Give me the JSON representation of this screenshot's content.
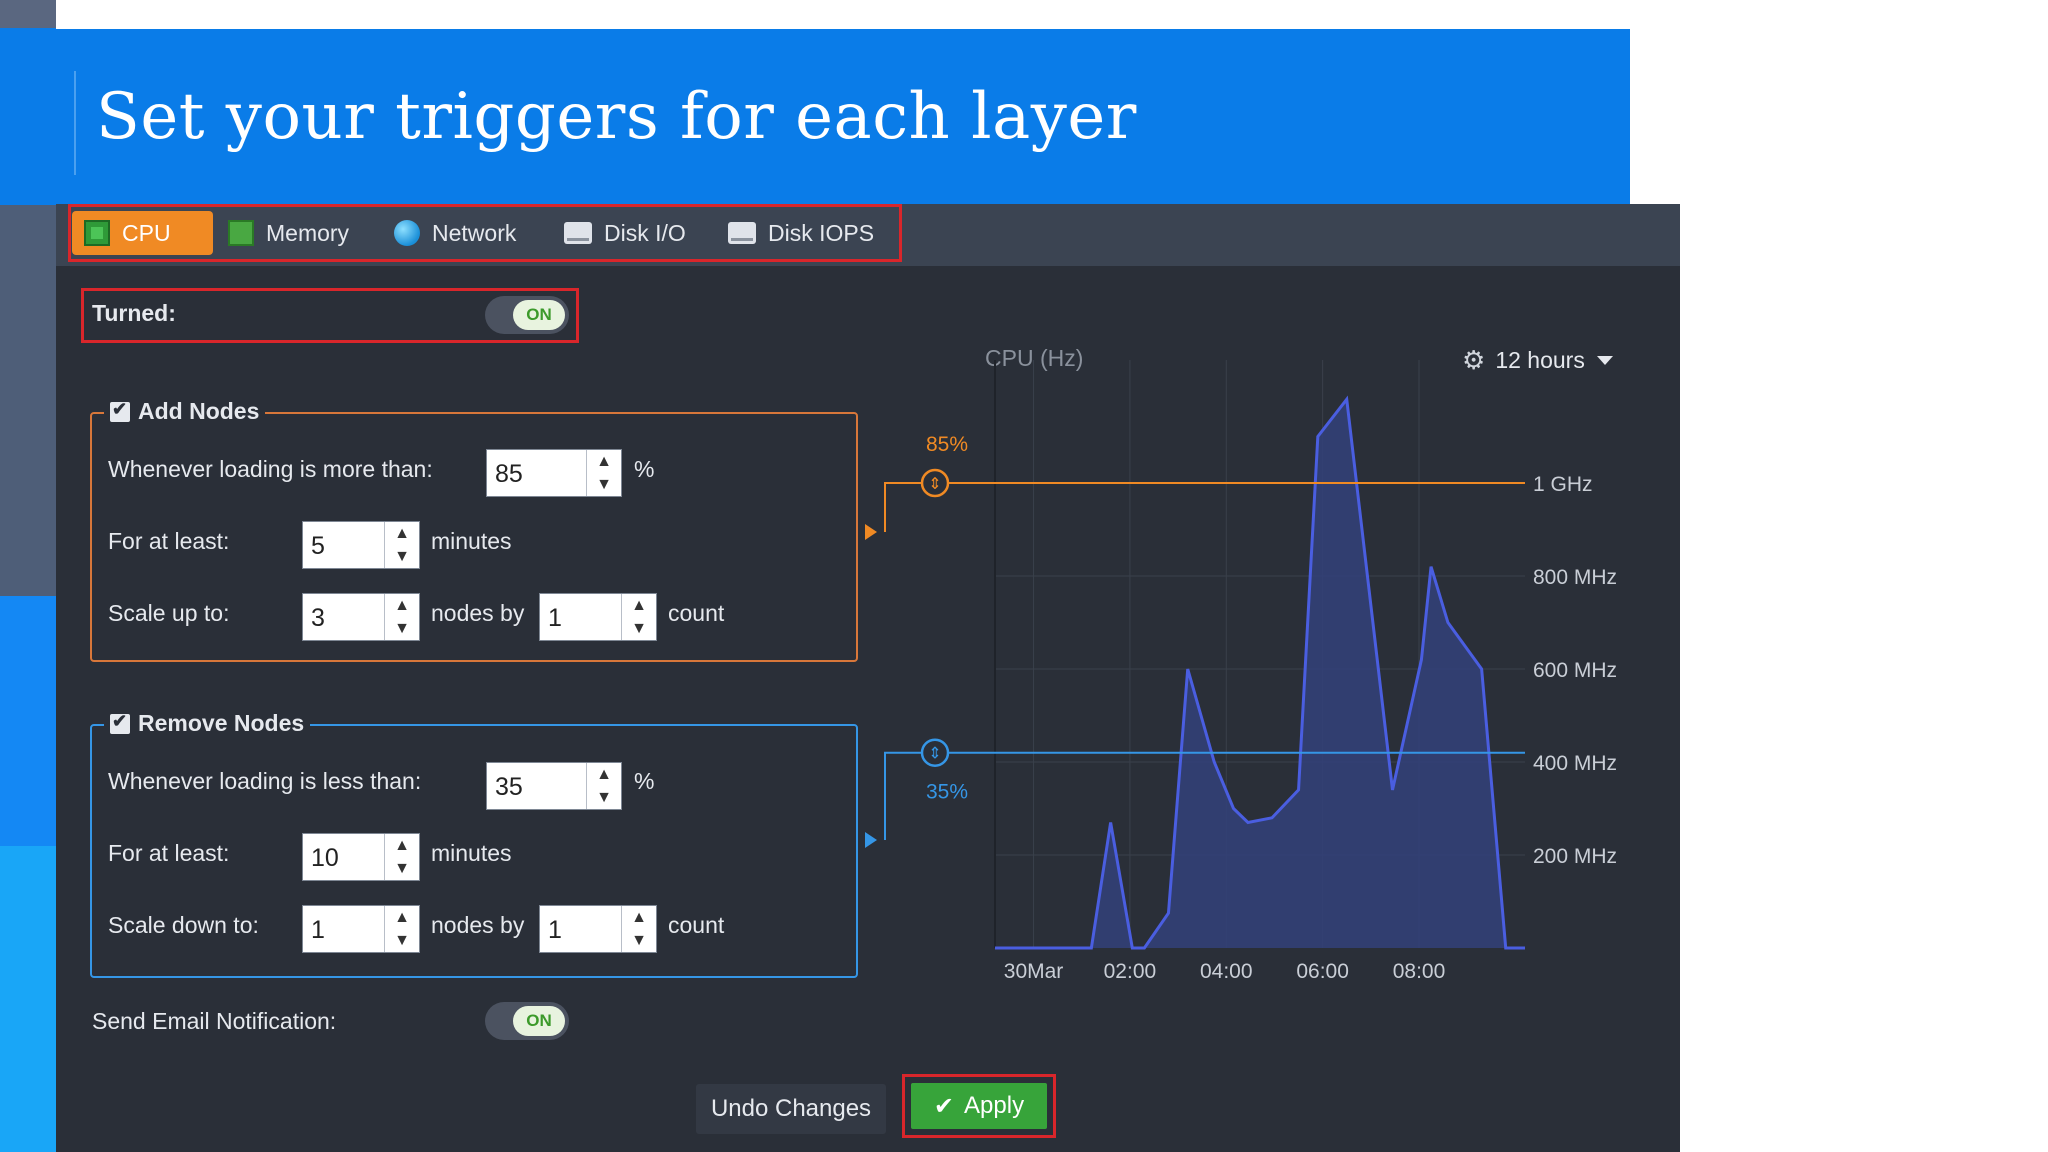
{
  "slide": {
    "title": "Set your triggers for each layer"
  },
  "tabs": [
    {
      "label": "CPU",
      "icon": "cpu-chip-icon",
      "active": true
    },
    {
      "label": "Memory",
      "icon": "memory-chip-icon",
      "active": false
    },
    {
      "label": "Network",
      "icon": "globe-icon",
      "active": false
    },
    {
      "label": "Disk I/O",
      "icon": "disk-icon",
      "active": false
    },
    {
      "label": "Disk IOPS",
      "icon": "disk-icon",
      "active": false
    }
  ],
  "turned": {
    "label": "Turned:",
    "state": "ON"
  },
  "add_nodes": {
    "legend": "Add Nodes",
    "checked": true,
    "loading_label": "Whenever loading is more than:",
    "loading_value": "85",
    "loading_unit": "%",
    "for_label": "For at least:",
    "for_value": "5",
    "for_unit": "minutes",
    "scale_label": "Scale up to:",
    "scale_value": "3",
    "nodes_by": "nodes by",
    "by_value": "1",
    "count": "count"
  },
  "remove_nodes": {
    "legend": "Remove Nodes",
    "checked": true,
    "loading_label": "Whenever loading is less than:",
    "loading_value": "35",
    "loading_unit": "%",
    "for_label": "For at least:",
    "for_value": "10",
    "for_unit": "minutes",
    "scale_label": "Scale down to:",
    "scale_value": "1",
    "nodes_by": "nodes by",
    "by_value": "1",
    "count": "count"
  },
  "email": {
    "label": "Send Email Notification:",
    "state": "ON"
  },
  "range_selector": {
    "label": "12 hours"
  },
  "buttons": {
    "undo": "Undo Changes",
    "apply": "Apply"
  },
  "colors": {
    "accent": "#f08a24",
    "remove": "#3596e6",
    "series": "#4a5ee0",
    "apply": "#37a43a",
    "highlight": "#d9262b"
  },
  "chart_data": {
    "type": "area",
    "title": "CPU (Hz)",
    "x_ticks": [
      "30Mar",
      "02:00",
      "04:00",
      "06:00",
      "08:00"
    ],
    "x_tick_hours": [
      0,
      2,
      4,
      6,
      8
    ],
    "y_ticks": [
      "200 MHz",
      "400 MHz",
      "600 MHz",
      "800 MHz",
      "1 GHz"
    ],
    "y_tick_values": [
      200,
      400,
      600,
      800,
      1000
    ],
    "ylim": [
      0,
      1200
    ],
    "xlim": [
      -0.8,
      10.2
    ],
    "series": [
      {
        "x": [
          -0.8,
          1.2,
          1.6,
          2.05,
          2.3,
          2.8,
          3.2,
          3.75,
          4.15,
          4.45,
          4.95,
          5.5,
          5.9,
          6.5,
          7.45,
          8.05,
          8.25,
          8.6,
          9.3,
          9.8,
          10.2
        ],
        "y": [
          0,
          0,
          270,
          0,
          0,
          75,
          600,
          400,
          300,
          270,
          280,
          340,
          1100,
          1180,
          340,
          620,
          820,
          700,
          600,
          0,
          0
        ]
      }
    ],
    "thresholds": [
      {
        "label": "85%",
        "value": 1000,
        "color": "#f08a24"
      },
      {
        "label": "35%",
        "value": 420,
        "color": "#3596e6"
      }
    ]
  }
}
